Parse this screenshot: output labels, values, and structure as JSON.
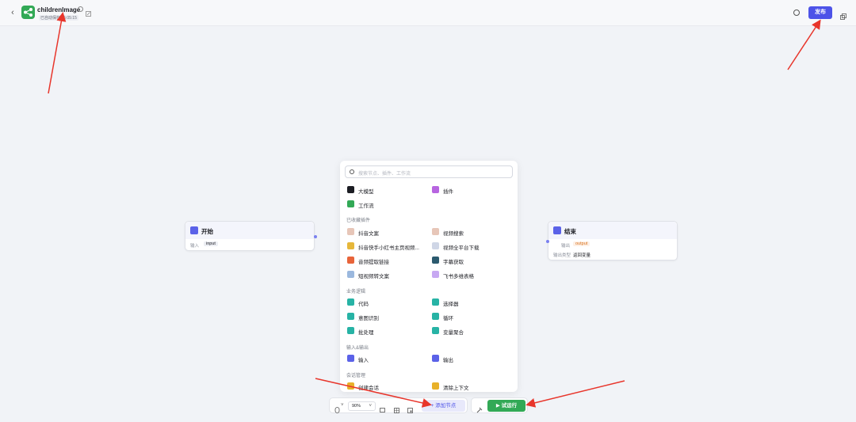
{
  "header": {
    "back": "‹",
    "title": "childrenImage",
    "autosave": "已自动保存 15:05:15",
    "publish": "发布"
  },
  "start_node": {
    "title": "开始",
    "input_label": "输入",
    "input_value": "input"
  },
  "end_node": {
    "title": "结束",
    "output_label": "输出",
    "output_value": "output",
    "answer_label": "输出类型",
    "answer_value": "返回变量"
  },
  "panel": {
    "search_placeholder": "搜索节点、插件、工作流",
    "basic": [
      "大模型",
      "插件",
      "工作流"
    ],
    "fav_title": "已收藏插件",
    "fav": [
      "抖音文案",
      "视频搜索",
      "抖音快手小红书主页视频...",
      "视频全平台下载",
      "音频提取链接",
      "字幕获取",
      "短视频转文案",
      "飞书多维表格"
    ],
    "logic_title": "业务逻辑",
    "logic": [
      "代码",
      "选择器",
      "意图识别",
      "循环",
      "批处理",
      "变量聚合"
    ],
    "io_title": "输入&输出",
    "io": [
      "输入",
      "输出"
    ],
    "session_title": "会话管理",
    "session": [
      "创建会话",
      "清除上下文"
    ]
  },
  "toolbar": {
    "zoom": "90%",
    "add_node": "添加节点",
    "run": "试运行"
  },
  "colors": {
    "accent": "#4d53e8",
    "green": "#32a956",
    "arrow": "#e8352b"
  }
}
